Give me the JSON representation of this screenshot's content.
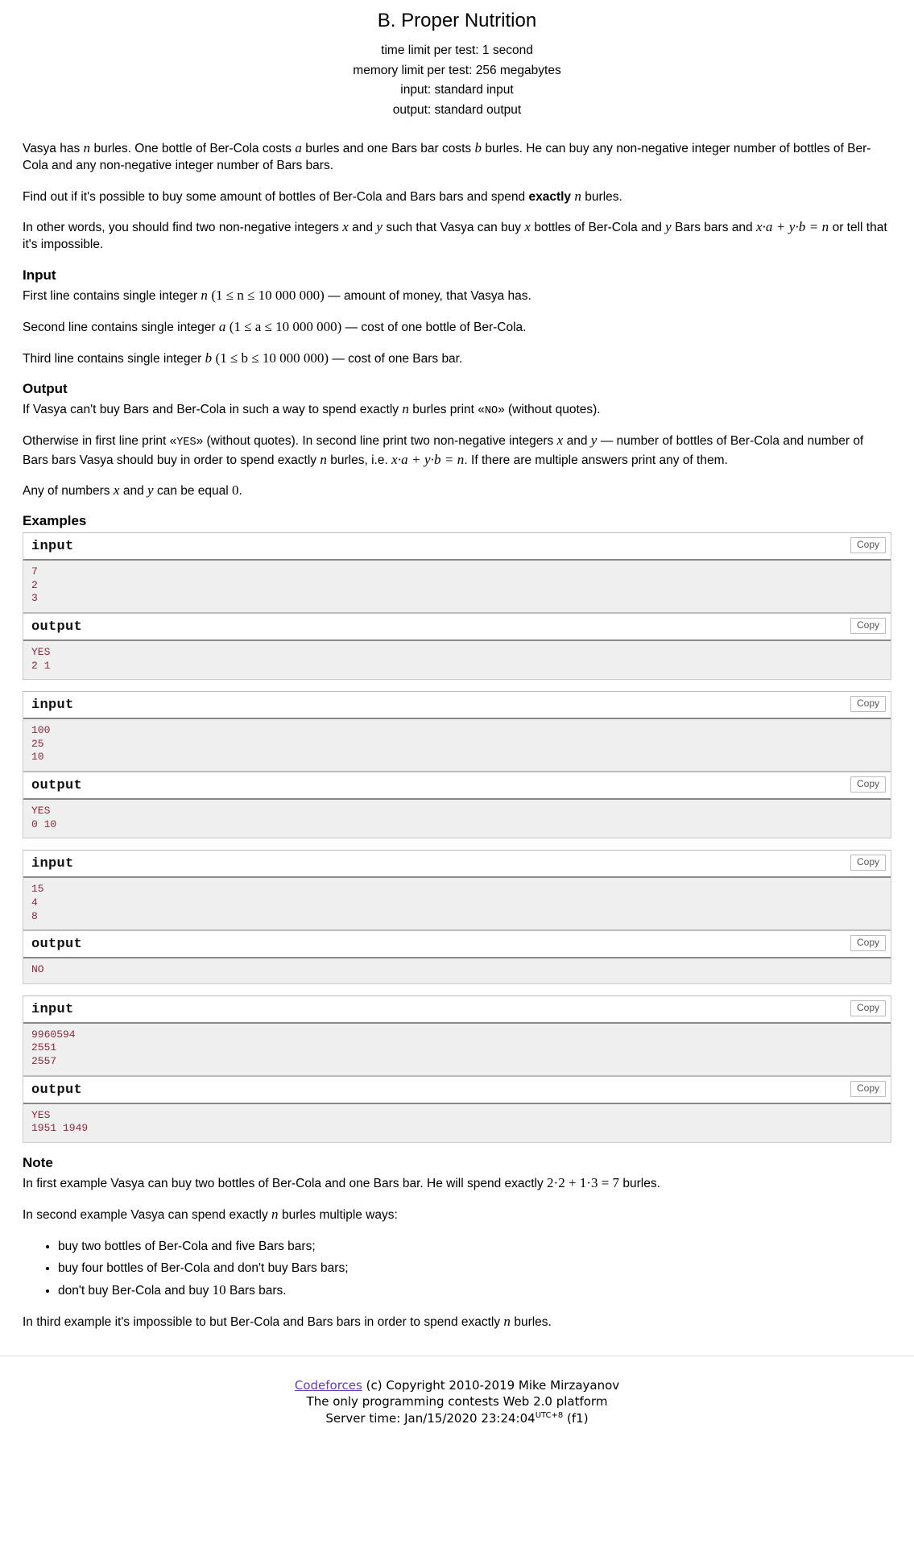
{
  "header": {
    "title": "B. Proper Nutrition",
    "time_limit": "time limit per test: 1 second",
    "memory_limit": "memory limit per test: 256 megabytes",
    "input_spec": "input: standard input",
    "output_spec": "output: standard output"
  },
  "legend": {
    "p1_a": "Vasya has ",
    "p1_n": "n",
    "p1_b": " burles. One bottle of Ber-Cola costs ",
    "p1_a2": "a",
    "p1_c": " burles and one Bars bar costs ",
    "p1_b2": "b",
    "p1_d": " burles. He can buy any non-negative integer number of bottles of Ber-Cola and any non-negative integer number of Bars bars.",
    "p2_a": "Find out if it's possible to buy some amount of bottles of Ber-Cola and Bars bars and spend ",
    "p2_bold": "exactly",
    "p2_b": " ",
    "p2_n": "n",
    "p2_c": " burles.",
    "p3_a": "In other words, you should find two non-negative integers ",
    "p3_x": "x",
    "p3_b": " and ",
    "p3_y": "y",
    "p3_c": " such that Vasya can buy ",
    "p3_x2": "x",
    "p3_d": " bottles of Ber-Cola and ",
    "p3_y2": "y",
    "p3_e": " Bars bars and ",
    "p3_formula": "x·a + y·b = n",
    "p3_f": " or tell that it's impossible."
  },
  "input_section": {
    "heading": "Input",
    "line1_a": "First line contains single integer ",
    "line1_var": "n",
    "line1_range": "(1 ≤ n ≤ 10 000 000)",
    "line1_b": " — amount of money, that Vasya has.",
    "line2_a": "Second line contains single integer ",
    "line2_var": "a",
    "line2_range": "(1 ≤ a ≤ 10 000 000)",
    "line2_b": " — cost of one bottle of Ber-Cola.",
    "line3_a": "Third line contains single integer ",
    "line3_var": "b",
    "line3_range": "(1 ≤ b ≤ 10 000 000)",
    "line3_b": " — cost of one Bars bar."
  },
  "output_section": {
    "heading": "Output",
    "p1_a": "If Vasya can't buy Bars and Ber-Cola in such a way to spend exactly ",
    "p1_n": "n",
    "p1_b": " burles print «",
    "p1_code": "NO",
    "p1_c": "» (without quotes).",
    "p2_a": "Otherwise in first line print «",
    "p2_code": "YES",
    "p2_b": "» (without quotes). In second line print two non-negative integers ",
    "p2_x": "x",
    "p2_c": " and ",
    "p2_y": "y",
    "p2_d": " — number of bottles of Ber-Cola and number of Bars bars Vasya should buy in order to spend exactly ",
    "p2_n": "n",
    "p2_e": " burles, i.e. ",
    "p2_formula": "x·a + y·b = n",
    "p2_f": ". If there are multiple answers print any of them.",
    "p3_a": "Any of numbers ",
    "p3_x": "x",
    "p3_b": " and ",
    "p3_y": "y",
    "p3_c": " can be equal ",
    "p3_zero": "0",
    "p3_d": "."
  },
  "examples": {
    "heading": "Examples",
    "input_label": "input",
    "output_label": "output",
    "copy_label": "Copy",
    "tests": [
      {
        "input": "7\n2\n3",
        "output": "YES\n2 1"
      },
      {
        "input": "100\n25\n10",
        "output": "YES\n0 10"
      },
      {
        "input": "15\n4\n8",
        "output": "NO"
      },
      {
        "input": "9960594\n2551\n2557",
        "output": "YES\n1951 1949"
      }
    ]
  },
  "note": {
    "heading": "Note",
    "p1_a": "In first example Vasya can buy two bottles of Ber-Cola and one Bars bar. He will spend exactly ",
    "p1_formula": "2·2 + 1·3 = 7",
    "p1_b": " burles.",
    "p2_a": "In second example Vasya can spend exactly ",
    "p2_n": "n",
    "p2_b": " burles multiple ways:",
    "bullets": [
      {
        "a": "buy two bottles of Ber-Cola and five Bars bars;",
        "num": "",
        "b": ""
      },
      {
        "a": "buy four bottles of Ber-Cola and don't buy Bars bars;",
        "num": "",
        "b": ""
      },
      {
        "a": "don't buy Ber-Cola and buy ",
        "num": "10",
        "b": " Bars bars."
      }
    ],
    "p3_a": "In third example it's impossible to but Ber-Cola and Bars bars in order to spend exactly ",
    "p3_n": "n",
    "p3_b": " burles."
  },
  "footer": {
    "brand": "Codeforces",
    "copyright": " (c) Copyright 2010-2019 Mike Mirzayanov",
    "tagline": "The only programming contests Web 2.0 platform",
    "server_time_prefix": "Server time: Jan/15/2020 23:24:04",
    "server_time_sup": "UTC+8",
    "server_time_suffix": " (f1)"
  }
}
